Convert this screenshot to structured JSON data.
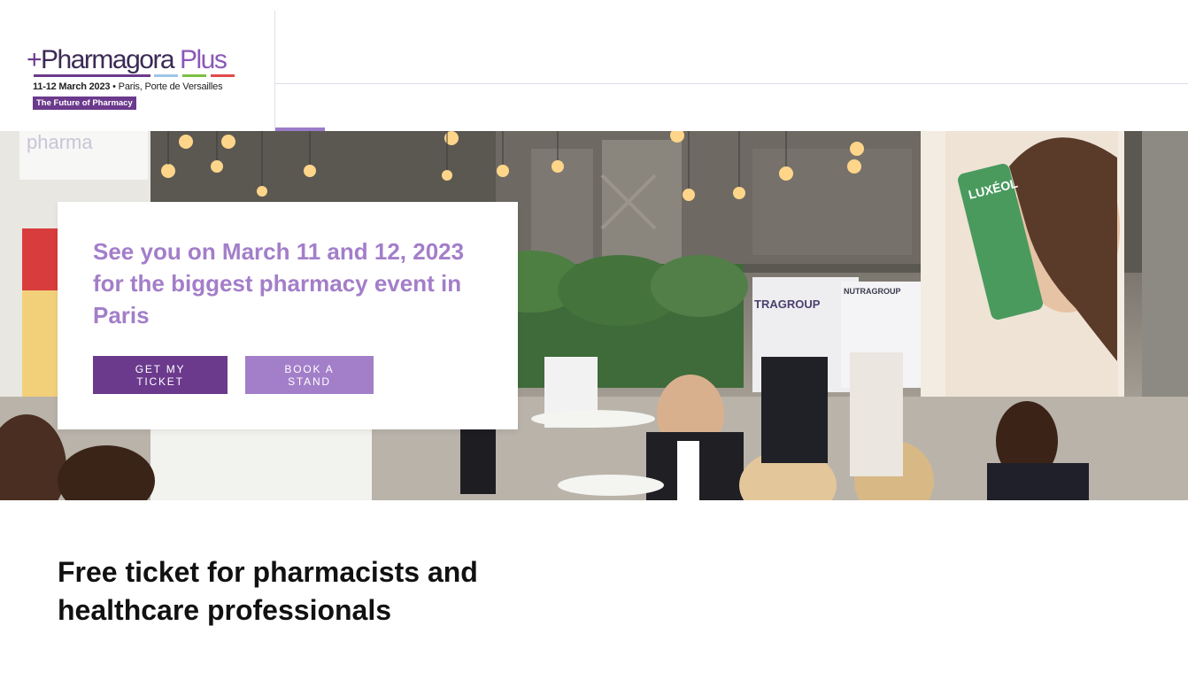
{
  "header": {
    "logo": {
      "plus_cross": "+",
      "word_pharmagora": "Pharmagora",
      "word_plus": " Plus",
      "dates_bold": "11-12 March 2023",
      "location": " • Paris, Porte de Versailles",
      "tagline": "The Future of Pharmacy",
      "stripe_colors": [
        "#6b3a8c",
        "#6b3a8c",
        "#6b3a8c",
        "#9ec5e8",
        "#7bc043",
        "#e04a4a"
      ]
    },
    "colors": {
      "accent_dark": "#6b3a8c",
      "accent_light": "#a37ec9"
    }
  },
  "hero": {
    "headline": "See you on March 11 and 12, 2023 for the biggest pharmacy event in Paris",
    "buttons": {
      "ticket": "GET MY TICKET",
      "stand": "BOOK A STAND"
    },
    "background": "photo of crowded pharmacy trade-show hall with hanging bulbs, plants and product banners"
  },
  "main": {
    "section_title": "Free ticket for pharmacists and healthcare professionals"
  }
}
